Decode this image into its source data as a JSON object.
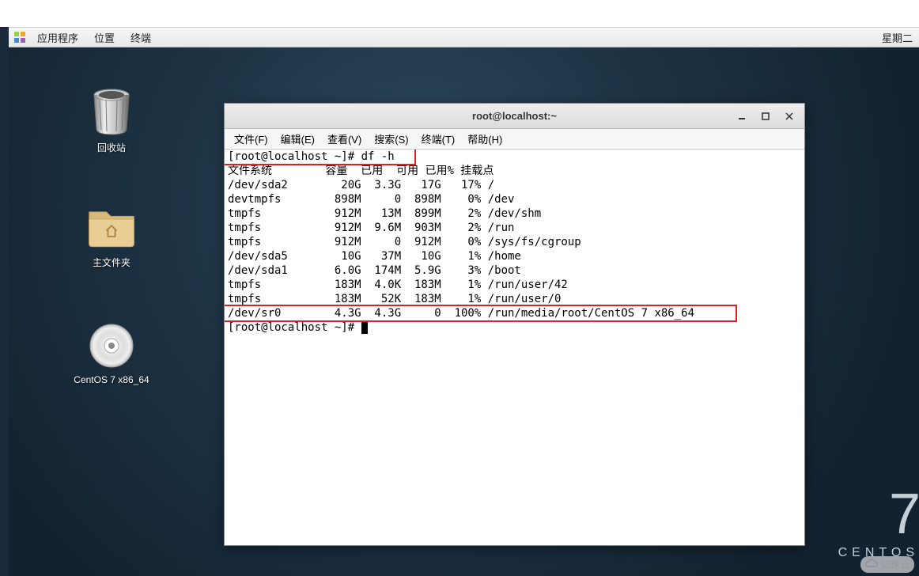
{
  "panel": {
    "apps": "应用程序",
    "places": "位置",
    "terminal": "终端",
    "clock": "星期二"
  },
  "desktop_icons": {
    "trash": "回收站",
    "home": "主文件夹",
    "cd": "CentOS 7 x86_64"
  },
  "terminal": {
    "title": "root@localhost:~",
    "menu": {
      "file": "文件(F)",
      "edit": "编辑(E)",
      "view": "查看(V)",
      "search": "搜索(S)",
      "term": "终端(T)",
      "help": "帮助(H)"
    },
    "prompt1": "[root@localhost ~]# df -h",
    "header": "文件系统        容量  已用  可用 已用% 挂载点",
    "rows": [
      "/dev/sda2        20G  3.3G   17G   17% /",
      "devtmpfs        898M     0  898M    0% /dev",
      "tmpfs           912M   13M  899M    2% /dev/shm",
      "tmpfs           912M  9.6M  903M    2% /run",
      "tmpfs           912M     0  912M    0% /sys/fs/cgroup",
      "/dev/sda5        10G   37M   10G    1% /home",
      "/dev/sda1       6.0G  174M  5.9G    3% /boot",
      "tmpfs           183M  4.0K  183M    1% /run/user/42",
      "tmpfs           183M   52K  183M    1% /run/user/0",
      "/dev/sr0        4.3G  4.3G     0  100% /run/media/root/CentOS 7 x86_64"
    ],
    "prompt2": "[root@localhost ~]# "
  },
  "brand": {
    "num": "7",
    "name": "CENTOS"
  },
  "watermark": "亿速云"
}
